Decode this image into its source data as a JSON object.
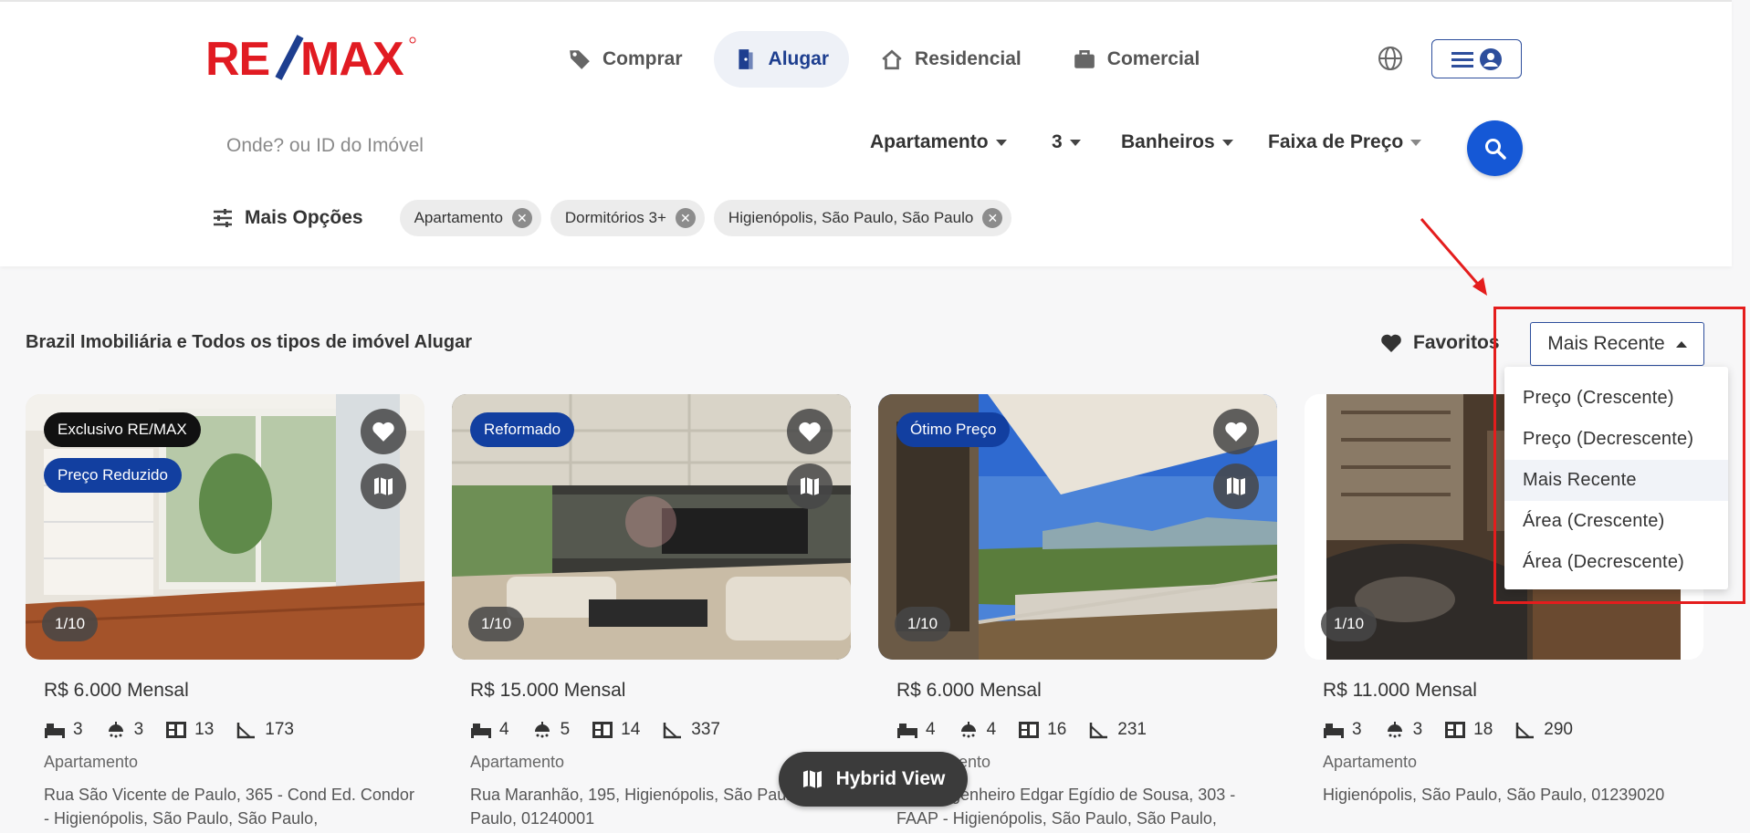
{
  "header": {
    "logo_text": "RE/MAX",
    "nav": [
      {
        "label": "Comprar",
        "icon": "tag-icon",
        "active": false
      },
      {
        "label": "Alugar",
        "icon": "door-icon",
        "active": true
      },
      {
        "label": "Residencial",
        "icon": "house-icon",
        "active": false
      },
      {
        "label": "Comercial",
        "icon": "briefcase-icon",
        "active": false
      }
    ]
  },
  "search": {
    "placeholder": "Onde? ou ID do Imóvel",
    "property_type": "Apartamento",
    "bedrooms": "3",
    "bathrooms": "Banheiros",
    "price_range": "Faixa de Preço"
  },
  "filters": {
    "more_options": "Mais Opções",
    "chips": [
      "Apartamento",
      "Dormitórios 3+",
      "Higienópolis, São Paulo, São Paulo"
    ]
  },
  "results": {
    "title": "Brazil Imobiliária e Todos os tipos de imóvel Alugar",
    "favorites": "Favoritos",
    "sort_selected": "Mais Recente",
    "sort_options": [
      "Preço (Crescente)",
      "Preço (Decrescente)",
      "Mais Recente",
      "Área (Crescente)",
      "Área (Decrescente)"
    ]
  },
  "listings": [
    {
      "badges": [
        "Exclusivo RE/MAX",
        "Preço Reduzido"
      ],
      "counter": "1/10",
      "price": "R$ 6.000 Mensal",
      "bedrooms": "3",
      "bathrooms": "3",
      "rooms": "13",
      "area": "173",
      "type": "Apartamento",
      "address": "Rua São Vicente de Paulo, 365 - Cond Ed. Condor - Higienópolis, São Paulo, São Paulo,"
    },
    {
      "badges": [
        "Reformado"
      ],
      "counter": "1/10",
      "price": "R$ 15.000 Mensal",
      "bedrooms": "4",
      "bathrooms": "5",
      "rooms": "14",
      "area": "337",
      "type": "Apartamento",
      "address": "Rua Maranhão, 195, Higienópolis, São Paulo, São Paulo, 01240001"
    },
    {
      "badges": [
        "Ótimo Preço"
      ],
      "counter": "1/10",
      "price": "R$ 6.000 Mensal",
      "bedrooms": "4",
      "bathrooms": "4",
      "rooms": "16",
      "area": "231",
      "type": "Apartamento",
      "address": "Rua Engenheiro Edgar Egídio de Sousa, 303 - FAAP - Higienópolis, São Paulo, São Paulo,"
    },
    {
      "badges": [],
      "counter": "1/10",
      "price": "R$ 11.000 Mensal",
      "bedrooms": "3",
      "bathrooms": "3",
      "rooms": "18",
      "area": "290",
      "type": "Apartamento",
      "address": "Higienópolis, São Paulo, São Paulo, 01239020"
    }
  ],
  "hybrid_view": "Hybrid View",
  "colors": {
    "brand_red": "#e11b22",
    "brand_blue": "#1d3e8f",
    "search_blue": "#1558d6",
    "annotation_red": "#e41d1d"
  }
}
